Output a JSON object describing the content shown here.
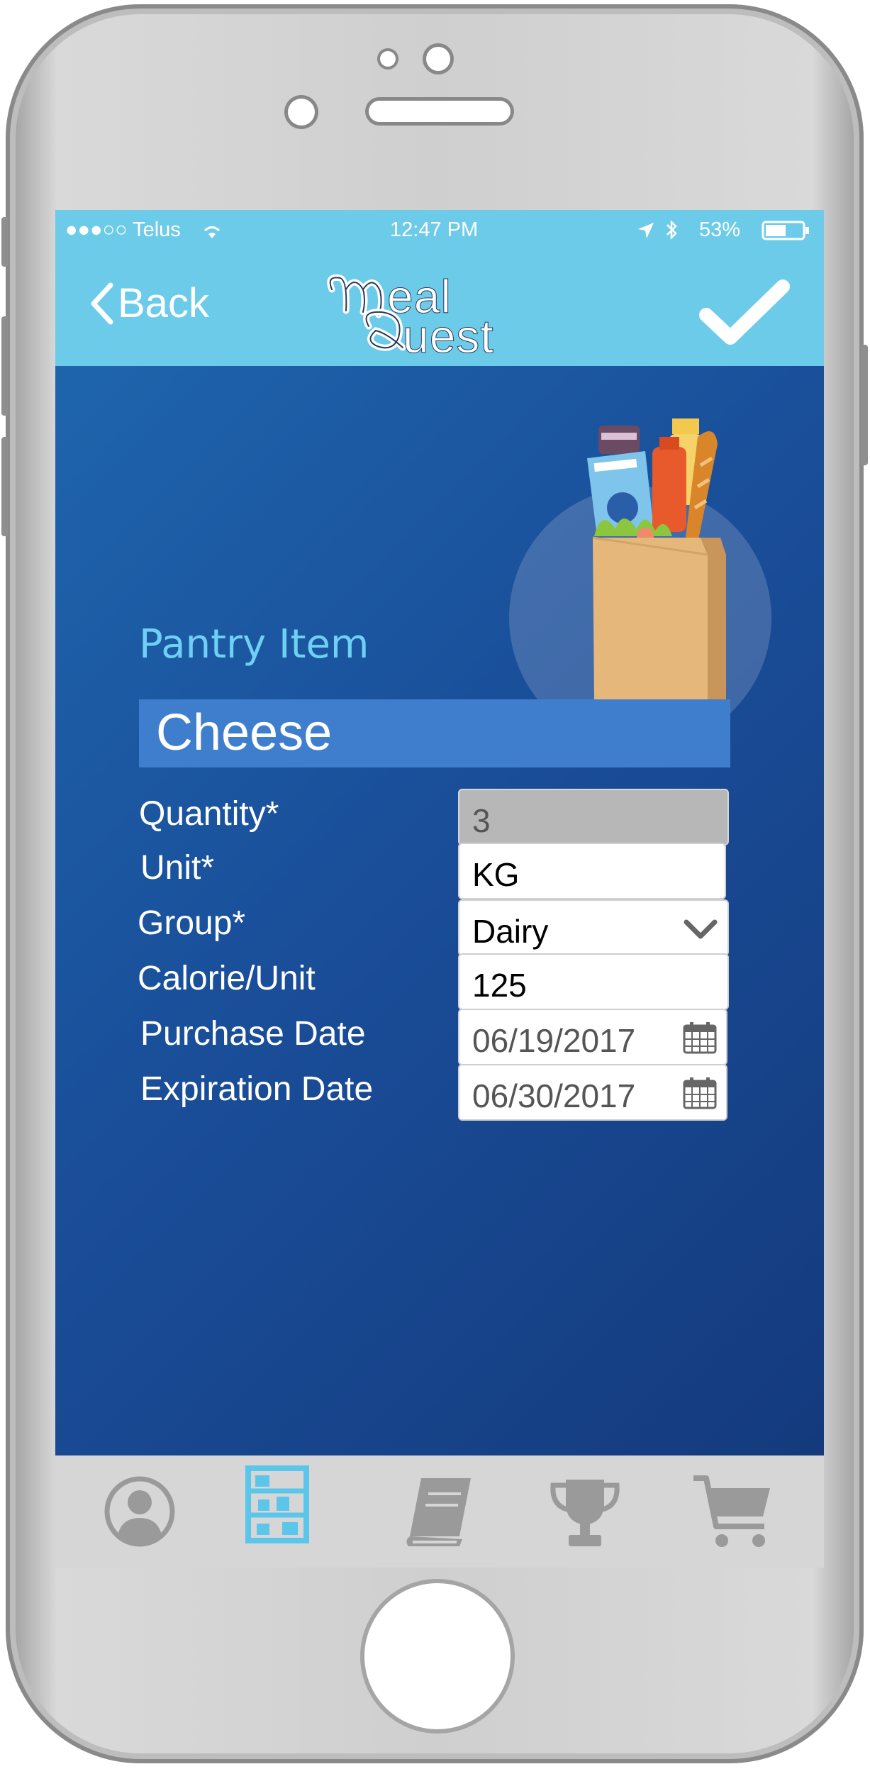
{
  "status_bar": {
    "carrier": "●●●○○ Telus",
    "time": "12:47 PM",
    "battery": "53%"
  },
  "nav": {
    "back_label": "Back",
    "logo_text_top": "eal",
    "logo_text_bottom": "uest",
    "confirm_icon": "checkmark-icon"
  },
  "form": {
    "section_title": "Pantry Item",
    "item_name": "Cheese",
    "fields": [
      {
        "label": "Quantity*",
        "value": "3",
        "state": "disabled"
      },
      {
        "label": "Unit*",
        "value": "KG"
      },
      {
        "label": "Group*",
        "value": "Dairy",
        "type": "select"
      },
      {
        "label": "Calorie/Unit",
        "value": "125"
      },
      {
        "label": "Purchase Date",
        "value": "06/19/2017",
        "type": "date"
      },
      {
        "label": "Expiration Date",
        "value": "06/30/2017",
        "type": "date"
      }
    ]
  },
  "tab_bar": {
    "tabs": [
      {
        "icon": "profile-icon",
        "active": false
      },
      {
        "icon": "pantry-shelves-icon",
        "active": true
      },
      {
        "icon": "recipe-book-icon",
        "active": false
      },
      {
        "icon": "trophy-icon",
        "active": false
      },
      {
        "icon": "shopping-cart-icon",
        "active": false
      }
    ]
  },
  "colors": {
    "nav_bar": "#6dcbea",
    "content_bg": "#1a4e99",
    "accent_title": "#6ed0f2",
    "name_box": "#3f7ecd",
    "tab_active": "#5cc6ea",
    "tab_inactive": "#9a9a9a"
  }
}
